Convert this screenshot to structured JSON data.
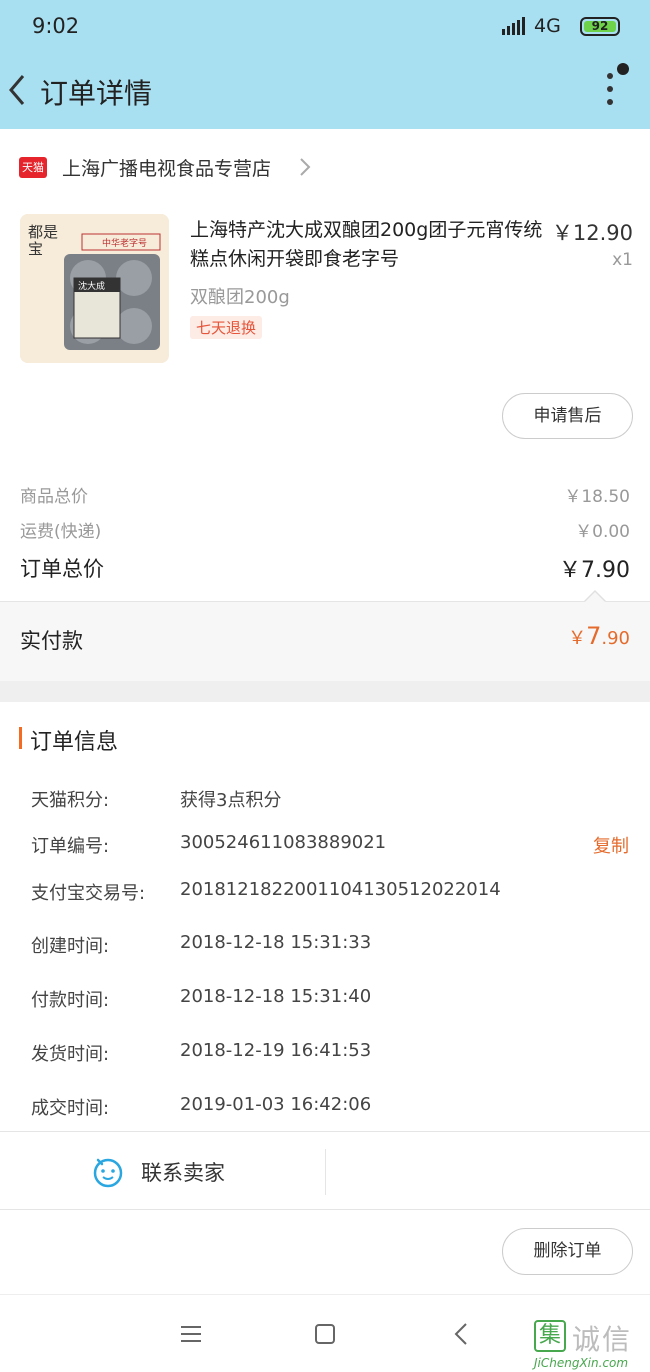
{
  "status_bar": {
    "time": "9:02",
    "network": "4G",
    "battery": "92"
  },
  "header": {
    "title": "订单详情"
  },
  "store": {
    "badge": "天猫",
    "name": "上海广播电视食品专营店"
  },
  "product": {
    "title": "上海特产沈大成双酿团200g团子元宵传统糕点休闲开袋即食老字号",
    "price": "￥12.90",
    "qty": "x1",
    "spec": "双酿团200g",
    "tag": "七天退换",
    "image_label": "都是宝",
    "image_brand": "中华老字号",
    "image_pack": "沈大成"
  },
  "after_sale_button": "申请售后",
  "summary": {
    "goods_label": "商品总价",
    "goods_value": "￥18.50",
    "shipping_label": "运费(快递)",
    "shipping_value": "￥0.00",
    "total_label": "订单总价",
    "total_value": "￥7.90",
    "paid_label": "实付款",
    "paid_currency": "￥",
    "paid_int": "7",
    "paid_dec": ".90"
  },
  "order_info": {
    "title": "订单信息",
    "rows": [
      {
        "label": "天猫积分:",
        "value": "获得3点积分"
      },
      {
        "label": "订单编号:",
        "value": "300524611083889021"
      },
      {
        "label": "支付宝交易号:",
        "value": "2018121822001104130512022014"
      },
      {
        "label": "创建时间:",
        "value": "2018-12-18 15:31:33"
      },
      {
        "label": "付款时间:",
        "value": "2018-12-18 15:31:40"
      },
      {
        "label": "发货时间:",
        "value": "2018-12-19 16:41:53"
      },
      {
        "label": "成交时间:",
        "value": "2019-01-03 16:42:06"
      }
    ],
    "copy_label": "复制"
  },
  "contact": {
    "label": "联系卖家"
  },
  "delete_button": "删除订单",
  "watermark": {
    "char": "集",
    "text": "诚信",
    "url": "JiChengXin.com"
  },
  "colors": {
    "header_bg": "#a8dff1",
    "accent": "#e56b2c",
    "tmall_red": "#e5242b"
  }
}
